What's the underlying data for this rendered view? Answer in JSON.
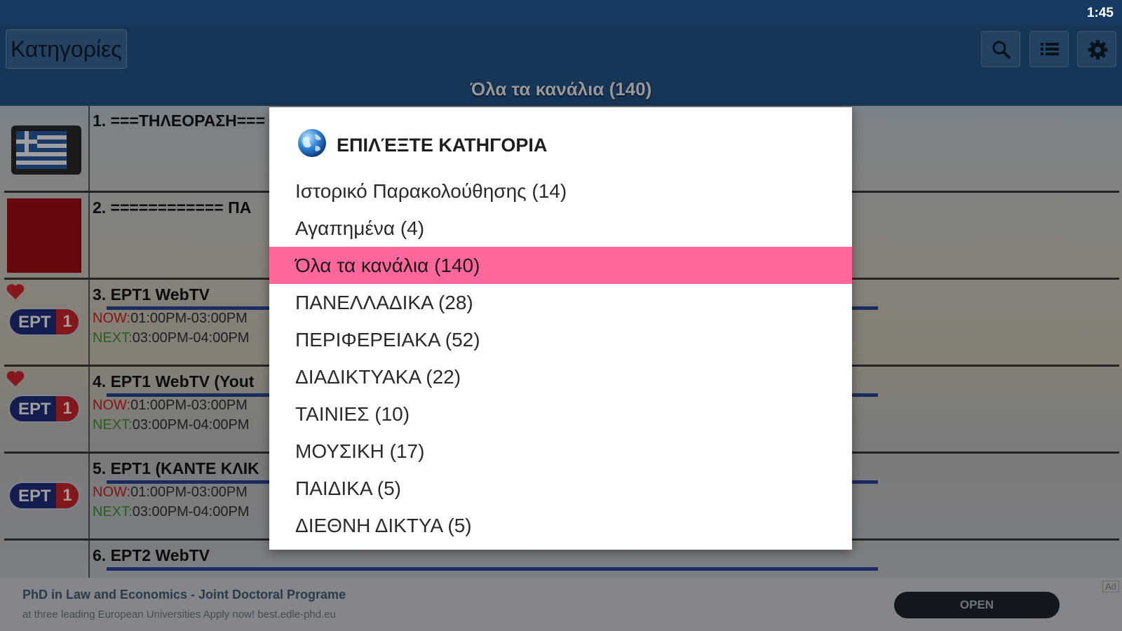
{
  "status_bar": {
    "time": "1:45"
  },
  "toolbar": {
    "categories_button": "Κατηγορίες",
    "icons": [
      "search-icon",
      "list-icon",
      "gear-icon"
    ],
    "subtitle": "Όλα τα κανάλια (140)"
  },
  "channels": [
    {
      "name": "1. ===ΤΗΛΕΟΡΑΣΗ===",
      "now": "",
      "now_time": "",
      "next": "",
      "next_time": ""
    },
    {
      "name": "2. ============ ΠΑ",
      "now": "",
      "now_time": "",
      "next": "",
      "next_time": ""
    },
    {
      "name": "3. ΕΡΤ1 WebTV",
      "now": "NOW:",
      "now_time": "01:00PM-03:00PM",
      "next": "NEXT:",
      "next_time": "03:00PM-04:00PM"
    },
    {
      "name": "4. ΕΡΤ1 WebTV (Yout",
      "now": "NOW:",
      "now_time": "01:00PM-03:00PM",
      "next": "NEXT:",
      "next_time": "03:00PM-04:00PM"
    },
    {
      "name": "5. ΕΡΤ1 (ΚΑΝΤΕ ΚΛΙΚ",
      "now": "NOW:",
      "now_time": "01:00PM-03:00PM",
      "next": "NEXT:",
      "next_time": "03:00PM-04:00PM"
    },
    {
      "name": "6. ΕΡΤ2 WebTV",
      "now": "",
      "now_time": "",
      "next": "",
      "next_time": ""
    }
  ],
  "logo": {
    "text": "ΕΡΤ",
    "number": "1"
  },
  "dialog": {
    "title": "ΕΠΙΛΈΞΤΕ ΚΑΤΗΓΟΡΙΑ",
    "items": [
      "Ιστορικό Παρακολούθησης (14)",
      "Αγαπημένα (4)",
      "Όλα τα κανάλια (140)",
      "ΠΑΝΕΛΛΑΔΙΚΑ (28)",
      "ΠΕΡΙΦΕΡΕΙΑΚΑ (52)",
      "ΔΙΑΔΙΚΤΥΑΚΑ (22)",
      "ΤΑΙΝΙΕΣ (10)",
      "ΜΟΥΣΙΚΗ (17)",
      "ΠΑΙΔΙΚΑ (5)",
      "ΔΙΕΘΝΗ ΔΙΚΤΥΑ (5)"
    ],
    "selected_index": 2,
    "selected_color": "#ff6699"
  },
  "ad": {
    "headline": "PhD in Law and Economics - Joint Doctoral Programe",
    "body": "at three leading European Universities Apply now! best.edle-phd.eu",
    "button": "OPEN",
    "tag": "Ad"
  }
}
